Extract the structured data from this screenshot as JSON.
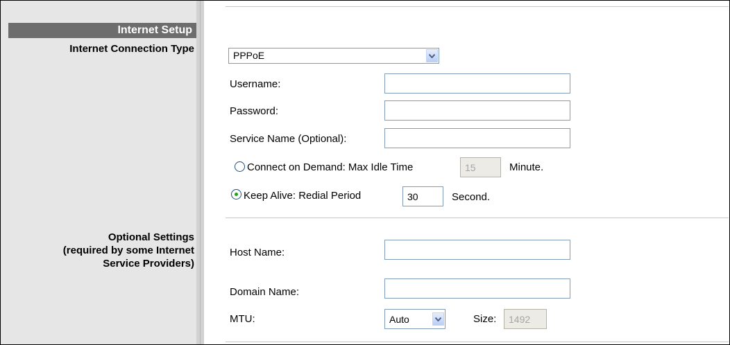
{
  "sidebar": {
    "section_header": "Internet Setup",
    "connection_type_label": "Internet Connection Type",
    "optional_settings_line1": "Optional Settings",
    "optional_settings_line2": "(required by some Internet",
    "optional_settings_line3": "Service Providers)"
  },
  "connection": {
    "type_selected": "PPPoE",
    "username_label": "Username:",
    "username_value": "",
    "password_label": "Password:",
    "password_value": "",
    "service_name_label": "Service Name (Optional):",
    "service_name_value": "",
    "connect_on_demand_label": "Connect on Demand: Max Idle Time",
    "connect_on_demand_selected": false,
    "max_idle_time_value": "15",
    "max_idle_time_unit": "Minute.",
    "keep_alive_label": "Keep Alive: Redial Period",
    "keep_alive_selected": true,
    "redial_period_value": "30",
    "redial_period_unit": "Second."
  },
  "optional": {
    "host_name_label": "Host Name:",
    "host_name_value": "",
    "domain_name_label": "Domain Name:",
    "domain_name_value": "",
    "mtu_label": "MTU:",
    "mtu_selected": "Auto",
    "size_label": "Size:",
    "size_value": "1492"
  },
  "icons": {
    "dropdown_arrow": "chevron-down-icon",
    "radio": "radio-icon"
  },
  "colors": {
    "section_header_bg": "#6d6d6d",
    "sidebar_bg": "#e6e6e6",
    "selected_radio": "#21a121",
    "input_border": "#7f9db9"
  }
}
